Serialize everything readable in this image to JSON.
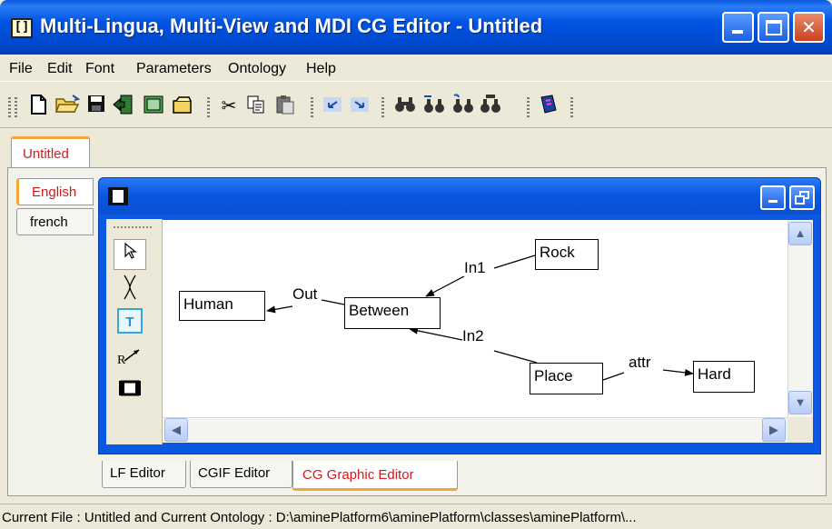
{
  "window": {
    "title": "Multi-Lingua, Multi-View and MDI CG Editor - Untitled",
    "icon": "app-frame-icon"
  },
  "menu": [
    "File",
    "Edit",
    "Font",
    "Parameters",
    "Ontology",
    "Help"
  ],
  "toolbar": {
    "icons": [
      "new-file-icon",
      "open-folder-icon",
      "save-icon",
      "exit-icon",
      "open-ontology-icon",
      "cut-icon",
      "copy-icon",
      "paste-icon",
      "undo-icon",
      "redo-icon",
      "find-icon",
      "find-next-icon",
      "find-replace-icon",
      "find-all-icon",
      "book-icon"
    ]
  },
  "document_tab": {
    "label": "Untitled"
  },
  "languages": [
    {
      "label": "English",
      "active": true
    },
    {
      "label": "french",
      "active": false
    }
  ],
  "palette": {
    "tools": [
      "select-arrow-icon",
      "coreference-icon",
      "text-icon",
      "relation-arrow-icon",
      "concept-frame-icon",
      "context-icon"
    ],
    "text_tool_label": "T",
    "relation_tool_label": "R"
  },
  "graph": {
    "concepts": [
      {
        "id": "rock",
        "label": "Rock"
      },
      {
        "id": "human",
        "label": "Human"
      },
      {
        "id": "between",
        "label": "Between"
      },
      {
        "id": "place",
        "label": "Place"
      },
      {
        "id": "hard",
        "label": "Hard"
      }
    ],
    "relations": [
      {
        "label": "In1",
        "from": "rock",
        "to": "between"
      },
      {
        "label": "Out",
        "from": "between",
        "to": "human"
      },
      {
        "label": "In2",
        "from": "place",
        "to": "between"
      },
      {
        "label": "attr",
        "from": "place",
        "to": "hard"
      }
    ]
  },
  "editor_tabs": [
    {
      "label": "LF Editor",
      "active": false
    },
    {
      "label": "CGIF Editor",
      "active": false
    },
    {
      "label": "CG Graphic Editor",
      "active": true
    }
  ],
  "status": {
    "text": "Current File : Untitled and Current Ontology : D:\\aminePlatform6\\aminePlatform\\classes\\aminePlatform\\..."
  },
  "colors": {
    "title_bar": "#0054e3",
    "active_tab_text": "#d11a1a",
    "tab_accent": "#f2a53a"
  }
}
